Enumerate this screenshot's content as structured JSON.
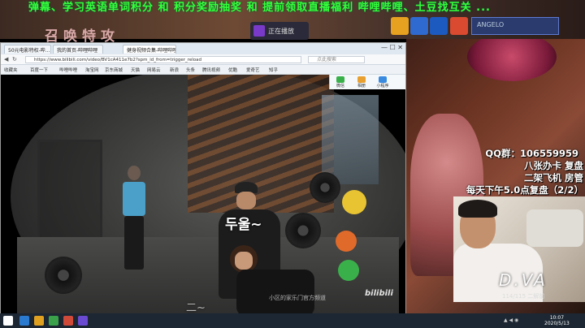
{
  "stream": {
    "marquee": "弹幕、学习英语单词积分 和 积分奖励抽奖 和 提前领取直播福利 哔哩哔哩、土豆找互关 ...",
    "logo_text": "召唤特攻",
    "now_playing": "正在播放",
    "hero_name": "ANGELO"
  },
  "browser": {
    "tabs": [
      "50元电影特权-哔...",
      "我的首页-哔哩哔哩",
      "健身视频合集-哔哩哔哩"
    ],
    "window_controls": "— ☐ ✕",
    "url": "https://www.bilibili.com/video/BV1cA411e7b2?spm_id_from=trigger_reload",
    "search_placeholder": "点此搜索",
    "bookmarks": [
      "收藏夹",
      "百度一下",
      "哔哩哔哩",
      "淘宝网",
      "京东商城",
      "天猫",
      "网易云",
      "新浪",
      "头条",
      "腾讯视频",
      "优酷",
      "爱奇艺",
      "知乎"
    ],
    "right_panel": [
      "微信",
      "相册",
      "小程序"
    ]
  },
  "video": {
    "caption_korean": "두울~",
    "caption_sub": "二~",
    "watermark": "小区的家乐门官方频道",
    "logo": "bilibili"
  },
  "overlay": {
    "qq": "QQ群：106559959",
    "line2": "八张办卡 复盘",
    "line3": "二架飞机 房管",
    "line4": "每天下午5.0点复盘（2/2）"
  },
  "webcam": {
    "label": "D.VA",
    "sub": "114/115 二解前"
  },
  "taskbar": {
    "time": "10:07",
    "date": "2020/5/13"
  },
  "colors": {
    "marquee": "#35ff3a",
    "taskbar": "#1c2733"
  }
}
